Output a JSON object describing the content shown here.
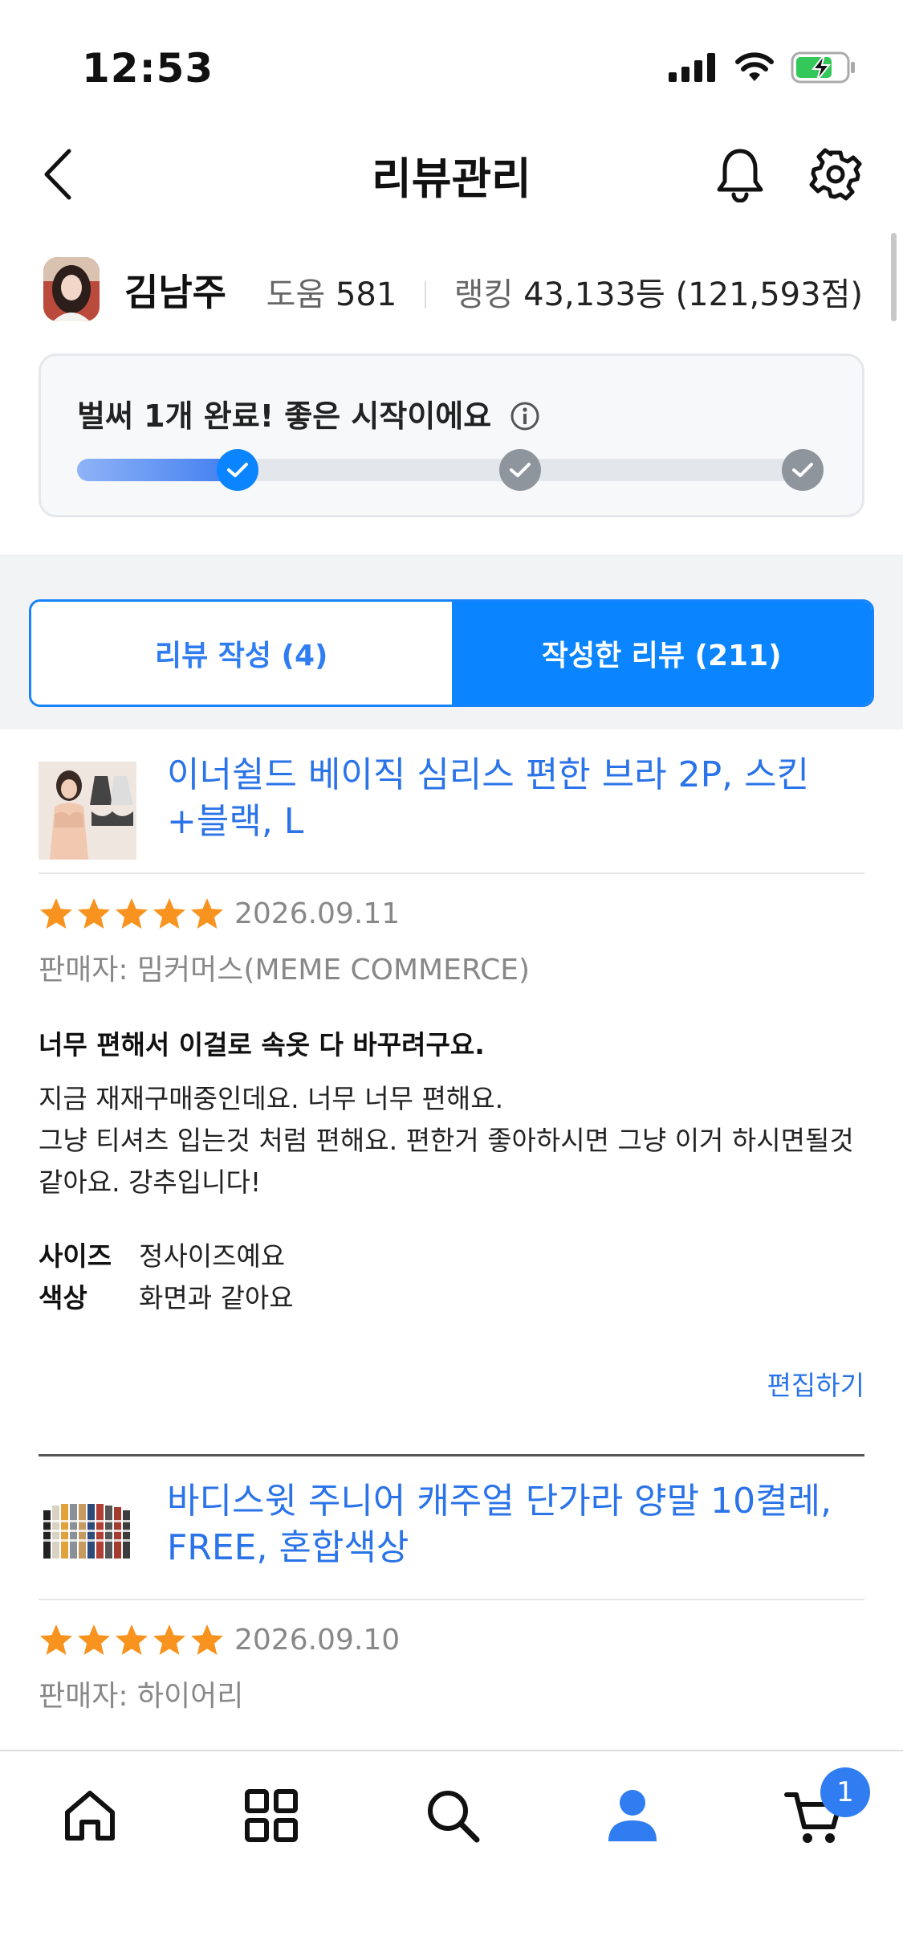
{
  "status_bar": {
    "time": "12:53"
  },
  "header": {
    "title": "리뷰관리"
  },
  "profile": {
    "name": "김남주",
    "help_label": "도움",
    "help_count": "581",
    "ranking_label": "랭킹",
    "ranking_value": "43,133등 (121,593점)"
  },
  "progress": {
    "message": "벌써 1개 완료! 좋은 시작이에요",
    "completed_steps": 1,
    "total_steps": 3
  },
  "tabs": [
    {
      "label": "리뷰 작성 (4)",
      "active": false
    },
    {
      "label": "작성한 리뷰 (211)",
      "active": true
    }
  ],
  "reviews": [
    {
      "product": "이너쉴드 베이직 심리스 편한 브라 2P, 스킨+블랙, L",
      "rating": 5,
      "date": "2026.09.11",
      "seller": "판매자: 밈커머스(MEME COMMERCE)",
      "title": "너무 편해서 이걸로 속옷 다 바꾸려구요.",
      "body": "지금 재재구매중인데요. 너무 너무 편해요.\n그냥 티셔츠 입는것 처럼 편해요. 편한거 좋아하시면 그냥 이거 하시면될것 같아요. 강추입니다!",
      "attributes": [
        {
          "key": "사이즈",
          "value": "정사이즈예요"
        },
        {
          "key": "색상",
          "value": "화면과 같아요"
        }
      ],
      "edit_label": "편집하기"
    },
    {
      "product": "바디스윗 주니어 캐주얼 단가라 양말 10켤레, FREE, 혼합색상",
      "rating": 5,
      "date": "2026.09.10",
      "seller": "판매자: 하이어리"
    }
  ],
  "bottom_nav": {
    "items": [
      "home-icon",
      "categories-icon",
      "search-icon",
      "my-page-icon",
      "cart-icon"
    ],
    "active": "my-page-icon",
    "cart_badge": "1"
  },
  "colors": {
    "accent": "#0a84ff",
    "link": "#2a73e8",
    "star": "#f7931e"
  }
}
